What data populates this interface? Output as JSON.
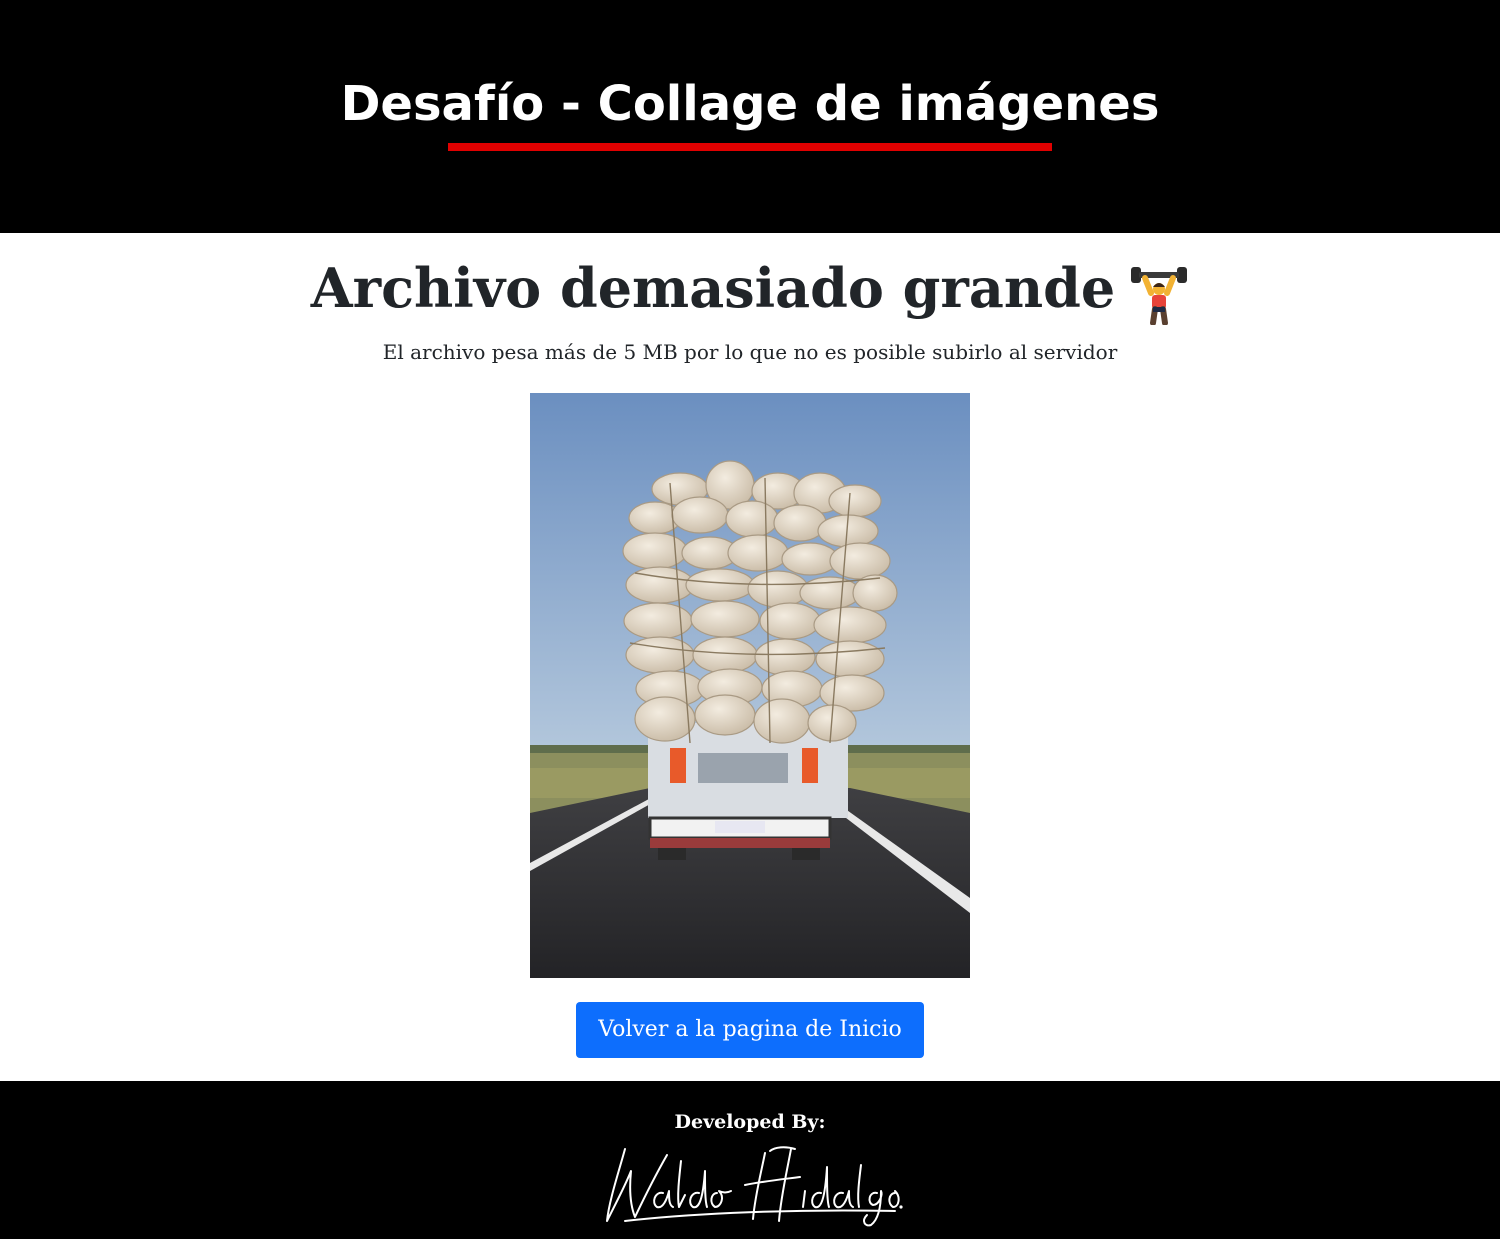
{
  "header": {
    "title": "Desafío - Collage de imágenes",
    "underline_color": "#e00000"
  },
  "main": {
    "heading": "Archivo demasiado grande",
    "heading_icon": "weight-lifter-icon",
    "subtitle": "El archivo pesa más de 5 MB por lo que no es posible subirlo al servidor",
    "photo": {
      "alt": "Camión sobrecargado con sacos en una carretera",
      "description_icon": "overloaded-truck-photo"
    },
    "home_button_label": "Volver a la pagina de Inicio",
    "button_color": "#0d6efd"
  },
  "footer": {
    "developed_by": "Developed By:",
    "signature_text": "Waldo Hidalgo."
  }
}
